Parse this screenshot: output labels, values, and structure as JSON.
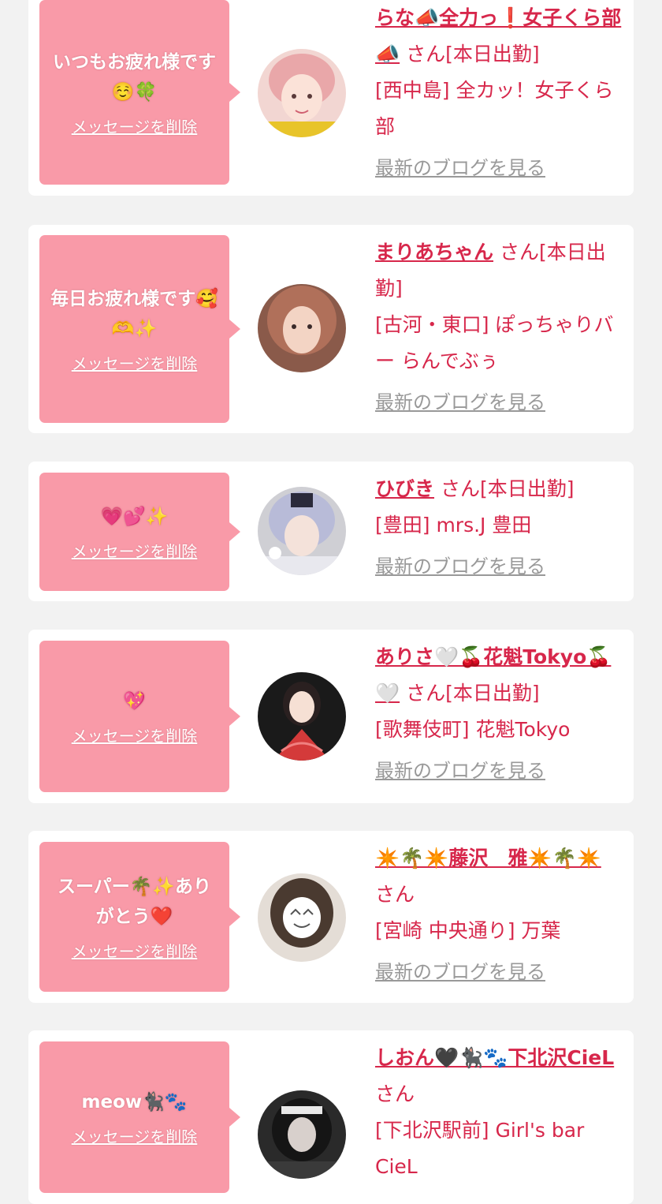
{
  "cards": [
    {
      "message": "いつもお疲れ様です☺️🍀",
      "delete_label": "メッセージを削除",
      "name": "らな📣全力っ❗女子くら部📣",
      "honorific": "さん",
      "status": "[本日出勤]",
      "shop": "[西中島] 全カッ！女子くら部",
      "blog_label": "最新のブログを見る"
    },
    {
      "message": "毎日お疲れ様です🥰🫶✨",
      "delete_label": "メッセージを削除",
      "name": "まりあちゃん",
      "honorific": "さん",
      "status": "[本日出勤]",
      "shop": "[古河・東口] ぽっちゃりバー らんでぶぅ",
      "blog_label": "最新のブログを見る"
    },
    {
      "message": "💗💕✨",
      "delete_label": "メッセージを削除",
      "name": "ひびき",
      "honorific": "さん",
      "status": "[本日出勤]",
      "shop": "[豊田] mrs.J 豊田",
      "blog_label": "最新のブログを見る"
    },
    {
      "message": "💖",
      "delete_label": "メッセージを削除",
      "name": "ありさ🤍🍒花魁Tokyo🍒🤍",
      "honorific": "さん",
      "status": "[本日出勤]",
      "shop": "[歌舞伎町] 花魁Tokyo",
      "blog_label": "最新のブログを見る"
    },
    {
      "message": "スーパー🌴✨ありがとう❤️",
      "delete_label": "メッセージを削除",
      "name": "✴️🌴✴️藤沢　雅✴️🌴✴️",
      "honorific": "さん",
      "status": "",
      "shop": "[宮崎 中央通り] 万葉",
      "blog_label": "最新のブログを見る"
    },
    {
      "message": "meow🐈‍⬛🐾",
      "delete_label": "メッセージを削除",
      "name": "しおん🖤🐈‍⬛🐾下北沢CieL",
      "honorific": "さん",
      "status": "",
      "shop": "[下北沢駅前] Girl's bar CieL",
      "blog_label": ""
    }
  ]
}
